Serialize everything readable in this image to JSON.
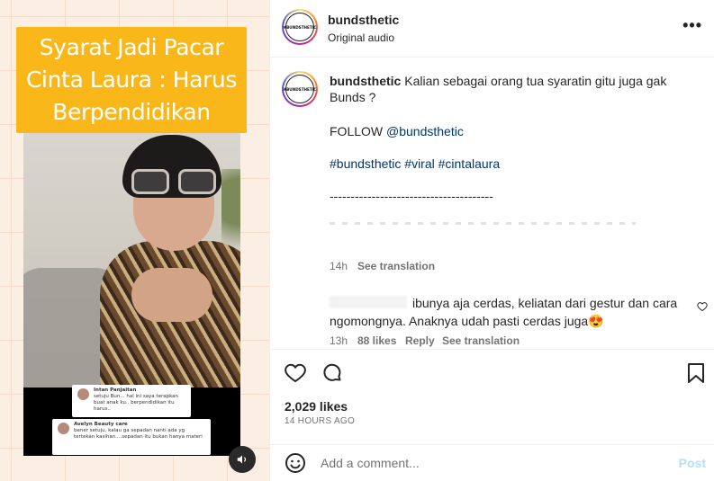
{
  "media": {
    "caption": "Syarat Jadi Pacar Cinta Laura : Harus Berpendidikan",
    "comment_card_1": {
      "name": "Intan Panjaitan",
      "text": "setuju Bun... hal ini saya terapkan buat anak ku.. berpendidikan itu harus.."
    },
    "comment_card_2": {
      "name": "Avelyn Beauty care",
      "text": "bener setuju, kalau ga sepadan nanti ada yg tertekan kasihan....sepadan itu bukan hanya materi"
    },
    "audio_icon": "speaker-icon"
  },
  "header": {
    "username": "bundsthetic",
    "audio": "Original audio",
    "avatar_text": "#BUNDSTHETIC",
    "more_icon": "more-horizontal-icon",
    "more_label": "•••"
  },
  "caption": {
    "username": "bundsthetic",
    "text": "Kalian sebagai orang tua syaratin gitu juga gak Bunds ?",
    "follow_prefix": "FOLLOW ",
    "follow_link": "@bundsthetic",
    "hashtags": "#bundsthetic #viral #cintalaura",
    "divider": "---------------------------------------",
    "time": "14h",
    "see_translation": "See translation"
  },
  "comment": {
    "text": "ibunya aja cerdas, keliatan dari gestur dan cara ngomongnya. Anaknya udah pasti cerdas juga😍",
    "time": "13h",
    "likes": "88 likes",
    "reply": "Reply",
    "see_translation": "See translation"
  },
  "actions": {
    "like_icon": "heart-icon",
    "comment_icon": "comment-icon",
    "save_icon": "bookmark-icon",
    "likes": "2,029 likes",
    "timestamp": "14 HOURS AGO"
  },
  "add_comment": {
    "emoji_icon": "emoji-icon",
    "placeholder": "Add a comment...",
    "post_label": "Post"
  },
  "colors": {
    "caption_bg": "#f9b71a",
    "link": "#00376b",
    "muted": "#737373",
    "post_disabled": "#b2dffc"
  }
}
